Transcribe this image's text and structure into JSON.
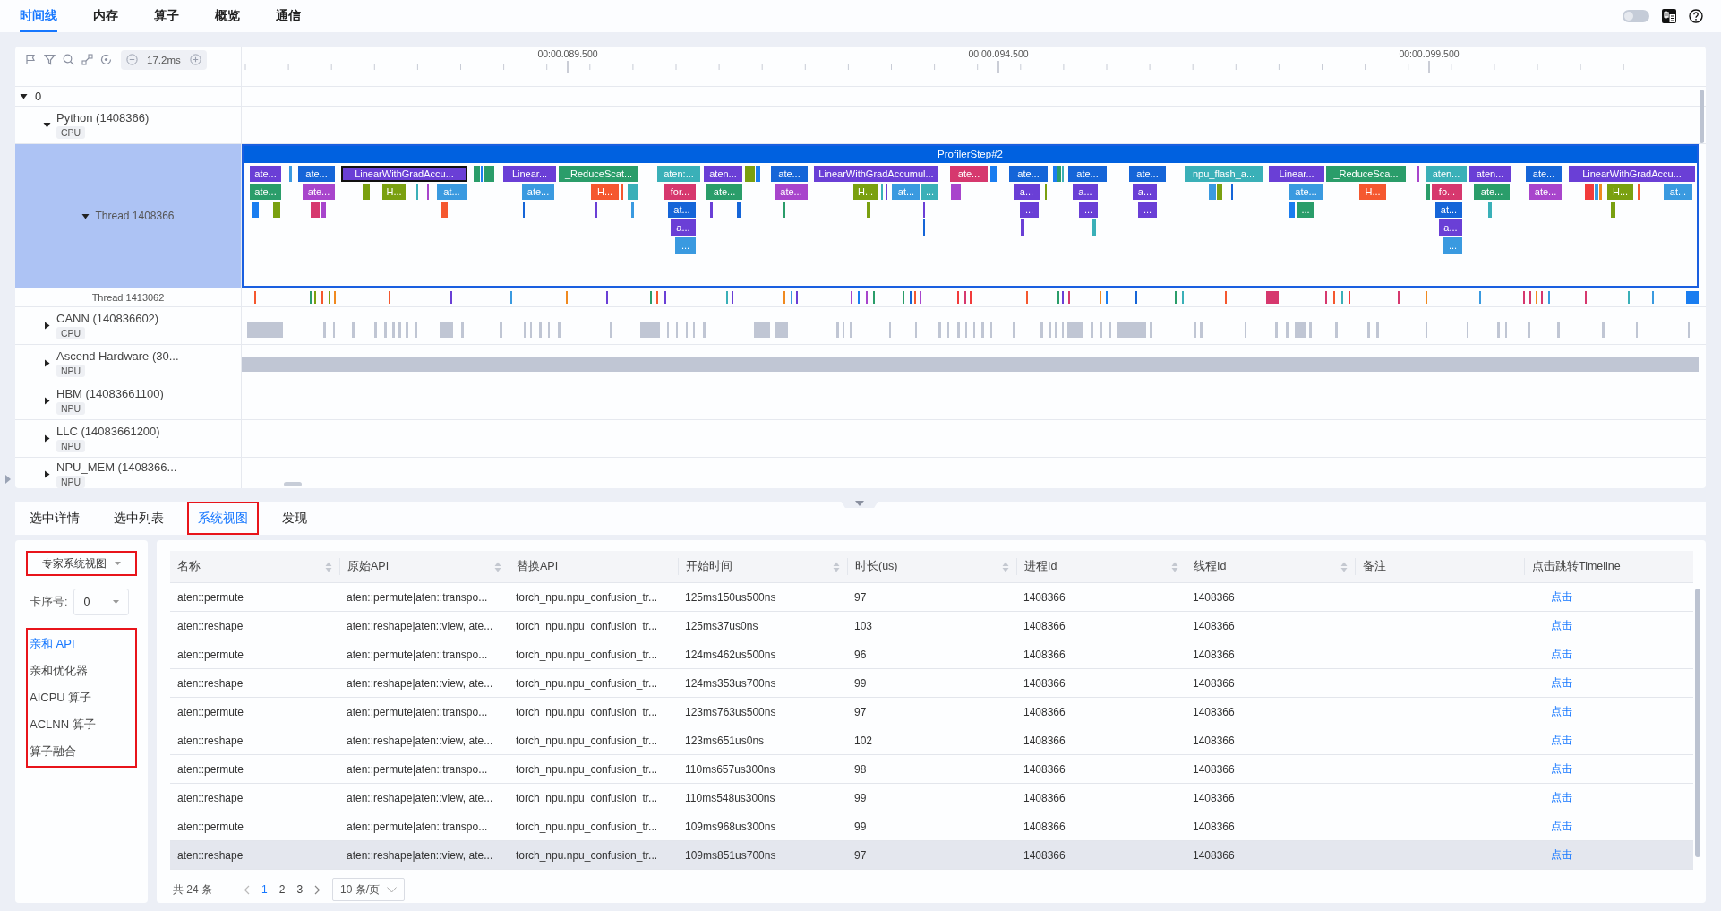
{
  "nav": {
    "tabs": [
      {
        "label": "时间线",
        "selected": true
      },
      {
        "label": "内存",
        "selected": false
      },
      {
        "label": "算子",
        "selected": false
      },
      {
        "label": "概览",
        "selected": false
      },
      {
        "label": "通信",
        "selected": false
      }
    ],
    "toggle": {
      "on": false
    }
  },
  "toolbar": {
    "zoom": "17.2ms"
  },
  "ruler": {
    "ticks": [
      "00:00.089.500",
      "00:00.094.500",
      "00:00.099.500"
    ]
  },
  "tree": {
    "root": {
      "label": "0",
      "expanded": true
    },
    "processes": [
      {
        "name": "Python (1408366)",
        "tag": "CPU",
        "expanded": true,
        "kind": "empty",
        "threads": [
          {
            "name": "Thread 1408366",
            "expanded": true,
            "selected": true,
            "kind": "flame"
          },
          {
            "name": "Thread 1413062",
            "selected": false,
            "kind": "ticks"
          }
        ]
      },
      {
        "name": "CANN (140836602)",
        "tag": "CPU",
        "expanded": false,
        "kind": "blocks"
      },
      {
        "name": "Ascend Hardware (30...",
        "tag": "NPU",
        "expanded": false,
        "kind": "bar"
      },
      {
        "name": "HBM (14083661100)",
        "tag": "NPU",
        "expanded": false,
        "kind": "empty"
      },
      {
        "name": "LLC (14083661200)",
        "tag": "NPU",
        "expanded": false,
        "kind": "empty"
      },
      {
        "name": "NPU_MEM (1408366...",
        "tag": "NPU",
        "expanded": false,
        "kind": "empty"
      }
    ]
  },
  "flame": {
    "title": "ProfilerStep#2",
    "slices": [
      {
        "label": "ate...",
        "color": "#6a3fd6",
        "selected": false,
        "children": [
          {
            "label": "ate...",
            "color": "#2a9d6a",
            "selected": false
          }
        ]
      },
      {
        "label": "ate...",
        "color": "#1565d8",
        "selected": false,
        "children": [
          {
            "label": "ate...",
            "color": "#a845cc",
            "selected": false
          }
        ]
      },
      {
        "label": "LinearWithGradAccu...",
        "color": "#6a3fd6",
        "selected": true,
        "children": [
          {
            "label": "H...",
            "color": "#7aa010",
            "selected": false
          },
          {
            "label": "at...",
            "color": "#3a9ae0",
            "selected": false
          }
        ]
      },
      {
        "label": "Linear...",
        "color": "#6a3fd6",
        "selected": false,
        "children": [
          {
            "label": "ate...",
            "color": "#3a9ae0",
            "selected": false
          }
        ]
      },
      {
        "label": "_ReduceScat...",
        "color": "#2a9d6a",
        "selected": false,
        "children": [
          {
            "label": "H...",
            "color": "#f5582f",
            "selected": false
          }
        ]
      },
      {
        "label": "aten:...",
        "color": "#3ab0b8",
        "selected": false,
        "children": [
          {
            "label": "for...",
            "color": "#d6386e",
            "selected": false,
            "children": [
              {
                "label": "at...",
                "color": "#1565d8",
                "selected": false,
                "children": [
                  {
                    "label": "a...",
                    "color": "#6a3fd6",
                    "selected": false,
                    "children": [
                      {
                        "label": "...",
                        "color": "#3a9ae0",
                        "selected": false
                      }
                    ]
                  }
                ]
              }
            ]
          }
        ]
      },
      {
        "label": "aten...",
        "color": "#6a3fd6",
        "selected": false,
        "children": [
          {
            "label": "ate...",
            "color": "#2a9d6a",
            "selected": false
          }
        ]
      },
      {
        "label": "ate...",
        "color": "#1565d8",
        "selected": false,
        "children": [
          {
            "label": "ate...",
            "color": "#a845cc",
            "selected": false
          }
        ]
      },
      {
        "label": "LinearWithGradAccumul...",
        "color": "#6a3fd6",
        "selected": false,
        "children": [
          {
            "label": "H...",
            "color": "#7aa010",
            "selected": false
          },
          {
            "label": "at...",
            "color": "#3a9ae0",
            "selected": false
          },
          {
            "label": "...",
            "color": "#3ab0b8",
            "selected": false
          }
        ]
      },
      {
        "label": "ate...",
        "color": "#d6386e",
        "selected": false
      },
      {
        "label": "ate...",
        "color": "#1565d8",
        "selected": false,
        "children": [
          {
            "label": "a...",
            "color": "#6a3fd6",
            "selected": false,
            "children": [
              {
                "label": "...",
                "color": "#6a3fd6",
                "selected": false
              }
            ]
          }
        ]
      },
      {
        "label": "ate...",
        "color": "#1565d8",
        "selected": false,
        "children": [
          {
            "label": "a...",
            "color": "#6a3fd6",
            "selected": false,
            "children": [
              {
                "label": "...",
                "color": "#6a3fd6",
                "selected": false
              }
            ]
          }
        ]
      },
      {
        "label": "ate...",
        "color": "#1565d8",
        "selected": false,
        "children": [
          {
            "label": "a...",
            "color": "#6a3fd6",
            "selected": false,
            "children": [
              {
                "label": "...",
                "color": "#6a3fd6",
                "selected": false
              }
            ]
          }
        ]
      },
      {
        "label": "npu_flash_a...",
        "color": "#3ab0b8",
        "selected": false
      },
      {
        "label": "Linear...",
        "color": "#6a3fd6",
        "selected": false,
        "children": [
          {
            "label": "ate...",
            "color": "#3a9ae0",
            "selected": false,
            "children": [
              {
                "label": "...",
                "color": "#2a9d6a",
                "selected": false
              }
            ]
          }
        ]
      },
      {
        "label": "_ReduceSca...",
        "color": "#2a9d6a",
        "selected": false,
        "children": [
          {
            "label": "H...",
            "color": "#f5582f",
            "selected": false
          }
        ]
      },
      {
        "label": "aten...",
        "color": "#3ab0b8",
        "selected": false,
        "children": [
          {
            "label": "fo...",
            "color": "#d6386e",
            "selected": false,
            "children": [
              {
                "label": "at...",
                "color": "#1565d8",
                "selected": false,
                "children": [
                  {
                    "label": "a...",
                    "color": "#6a3fd6",
                    "selected": false,
                    "children": [
                      {
                        "label": "...",
                        "color": "#3a9ae0",
                        "selected": false
                      }
                    ]
                  }
                ]
              }
            ]
          }
        ]
      },
      {
        "label": "aten...",
        "color": "#6a3fd6",
        "selected": false,
        "children": [
          {
            "label": "ate...",
            "color": "#2a9d6a",
            "selected": false
          }
        ]
      },
      {
        "label": "ate...",
        "color": "#1565d8",
        "selected": false,
        "children": [
          {
            "label": "ate...",
            "color": "#a845cc",
            "selected": false
          }
        ]
      },
      {
        "label": "LinearWithGradAccu...",
        "color": "#6a3fd6",
        "selected": false,
        "children": [
          {
            "label": "H...",
            "color": "#7aa010",
            "selected": false
          },
          {
            "label": "at...",
            "color": "#3a9ae0",
            "selected": false
          }
        ]
      }
    ]
  },
  "bottom_tabs": [
    {
      "label": "选中详情",
      "selected": false,
      "framed": false
    },
    {
      "label": "选中列表",
      "selected": false,
      "framed": false
    },
    {
      "label": "系统视图",
      "selected": true,
      "framed": true
    },
    {
      "label": "发现",
      "selected": false,
      "framed": false
    }
  ],
  "expert": {
    "view_select": {
      "value": "专家系统视图",
      "framed": true
    },
    "card_label": "卡序号:",
    "card_value": "0",
    "menu": {
      "framed": true,
      "items": [
        {
          "label": "亲和 API",
          "selected": true
        },
        {
          "label": "亲和优化器",
          "selected": false
        },
        {
          "label": "AICPU 算子",
          "selected": false
        },
        {
          "label": "ACLNN 算子",
          "selected": false
        },
        {
          "label": "算子融合",
          "selected": false
        }
      ]
    }
  },
  "table": {
    "columns": [
      {
        "label": "名称",
        "sortable": true
      },
      {
        "label": "原始API",
        "sortable": true
      },
      {
        "label": "替换API",
        "sortable": false
      },
      {
        "label": "开始时间",
        "sortable": true
      },
      {
        "label": "时长(us)",
        "sortable": true
      },
      {
        "label": "进程Id",
        "sortable": true
      },
      {
        "label": "线程Id",
        "sortable": true
      },
      {
        "label": "备注",
        "sortable": false
      },
      {
        "label": "点击跳转Timeline",
        "sortable": false
      }
    ],
    "rows": [
      {
        "hovered": false,
        "cells": [
          "aten::permute",
          "aten::permute|aten::transpo...",
          "torch_npu.npu_confusion_tr...",
          "125ms150us500ns",
          "97",
          "1408366",
          "1408366",
          "",
          "点击"
        ]
      },
      {
        "hovered": false,
        "cells": [
          "aten::reshape",
          "aten::reshape|aten::view, ate...",
          "torch_npu.npu_confusion_tr...",
          "125ms37us0ns",
          "103",
          "1408366",
          "1408366",
          "",
          "点击"
        ]
      },
      {
        "hovered": false,
        "cells": [
          "aten::permute",
          "aten::permute|aten::transpo...",
          "torch_npu.npu_confusion_tr...",
          "124ms462us500ns",
          "96",
          "1408366",
          "1408366",
          "",
          "点击"
        ]
      },
      {
        "hovered": false,
        "cells": [
          "aten::reshape",
          "aten::reshape|aten::view, ate...",
          "torch_npu.npu_confusion_tr...",
          "124ms353us700ns",
          "99",
          "1408366",
          "1408366",
          "",
          "点击"
        ]
      },
      {
        "hovered": false,
        "cells": [
          "aten::permute",
          "aten::permute|aten::transpo...",
          "torch_npu.npu_confusion_tr...",
          "123ms763us500ns",
          "97",
          "1408366",
          "1408366",
          "",
          "点击"
        ]
      },
      {
        "hovered": false,
        "cells": [
          "aten::reshape",
          "aten::reshape|aten::view, ate...",
          "torch_npu.npu_confusion_tr...",
          "123ms651us0ns",
          "102",
          "1408366",
          "1408366",
          "",
          "点击"
        ]
      },
      {
        "hovered": false,
        "cells": [
          "aten::permute",
          "aten::permute|aten::transpo...",
          "torch_npu.npu_confusion_tr...",
          "110ms657us300ns",
          "98",
          "1408366",
          "1408366",
          "",
          "点击"
        ]
      },
      {
        "hovered": false,
        "cells": [
          "aten::reshape",
          "aten::reshape|aten::view, ate...",
          "torch_npu.npu_confusion_tr...",
          "110ms548us300ns",
          "99",
          "1408366",
          "1408366",
          "",
          "点击"
        ]
      },
      {
        "hovered": false,
        "cells": [
          "aten::permute",
          "aten::permute|aten::transpo...",
          "torch_npu.npu_confusion_tr...",
          "109ms968us300ns",
          "99",
          "1408366",
          "1408366",
          "",
          "点击"
        ]
      },
      {
        "hovered": true,
        "cells": [
          "aten::reshape",
          "aten::reshape|aten::view, ate...",
          "torch_npu.npu_confusion_tr...",
          "109ms851us700ns",
          "97",
          "1408366",
          "1408366",
          "",
          "点击"
        ]
      }
    ]
  },
  "pagination": {
    "total": "共 24 条",
    "pages": [
      {
        "label": "1",
        "selected": true
      },
      {
        "label": "2",
        "selected": false
      },
      {
        "label": "3",
        "selected": false
      }
    ],
    "page_size": "10 条/页"
  }
}
